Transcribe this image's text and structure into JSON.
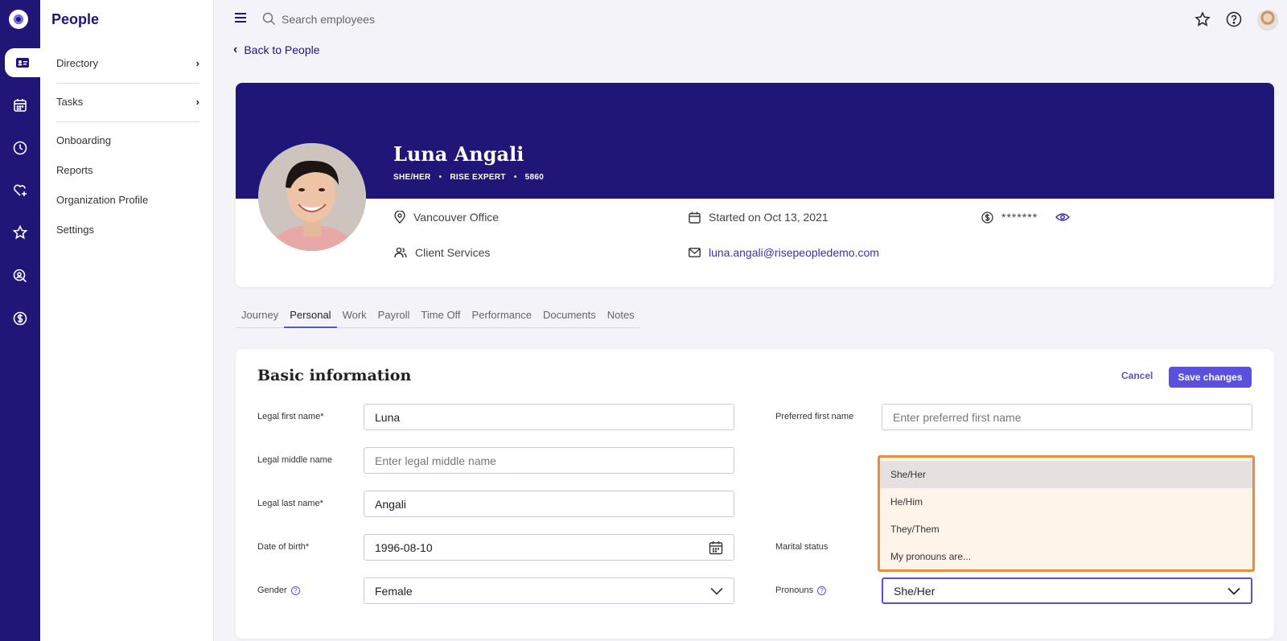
{
  "nav": {
    "title": "People",
    "items": [
      {
        "label": "Directory",
        "has_submenu": true
      },
      {
        "label": "Tasks",
        "has_submenu": true
      },
      {
        "label": "Onboarding"
      },
      {
        "label": "Reports"
      },
      {
        "label": "Organization Profile"
      },
      {
        "label": "Settings"
      }
    ]
  },
  "rail": {
    "icons": [
      "logo-icon",
      "people-card-icon",
      "calendar-icon",
      "clock-icon",
      "heart-plus-icon",
      "star-icon",
      "search-person-icon",
      "dollar-icon"
    ],
    "active": "people-card-icon"
  },
  "topbar": {
    "search_placeholder": "Search employees",
    "icons": [
      "star-icon",
      "help-icon",
      "user-avatar"
    ]
  },
  "back_link": "Back to People",
  "profile": {
    "name": "Luna Angali",
    "pronouns": "SHE/HER",
    "role": "RISE EXPERT",
    "employee_id": "5860",
    "office": "Vancouver Office",
    "department": "Client Services",
    "start": "Started on Oct 13, 2021",
    "email": "luna.angali@risepeopledemo.com",
    "salary_masked": "*******"
  },
  "tabs": [
    "Journey",
    "Personal",
    "Work",
    "Payroll",
    "Time Off",
    "Performance",
    "Documents",
    "Notes"
  ],
  "active_tab": "Personal",
  "basic_info": {
    "title": "Basic information",
    "cancel": "Cancel",
    "save": "Save changes",
    "legal_first_name": {
      "label": "Legal first name*",
      "value": "Luna"
    },
    "legal_middle_name": {
      "label": "Legal middle name",
      "placeholder": "Enter legal middle name"
    },
    "legal_last_name": {
      "label": "Legal last name*",
      "value": "Angali"
    },
    "date_of_birth": {
      "label": "Date of birth*",
      "value": "1996-08-10"
    },
    "gender": {
      "label": "Gender",
      "value": "Female"
    },
    "preferred_first_name": {
      "label": "Preferred first name",
      "placeholder": "Enter preferred first name"
    },
    "marital_status": {
      "label": "Marital status"
    },
    "pronouns": {
      "label": "Pronouns",
      "value": "She/Her",
      "options": [
        "She/Her",
        "He/Him",
        "They/Them",
        "My pronouns are..."
      ],
      "selected": "She/Her"
    }
  },
  "colors": {
    "brand": "#1f1678",
    "accent": "#5b4fe0",
    "highlight": "#ef8a3a"
  }
}
